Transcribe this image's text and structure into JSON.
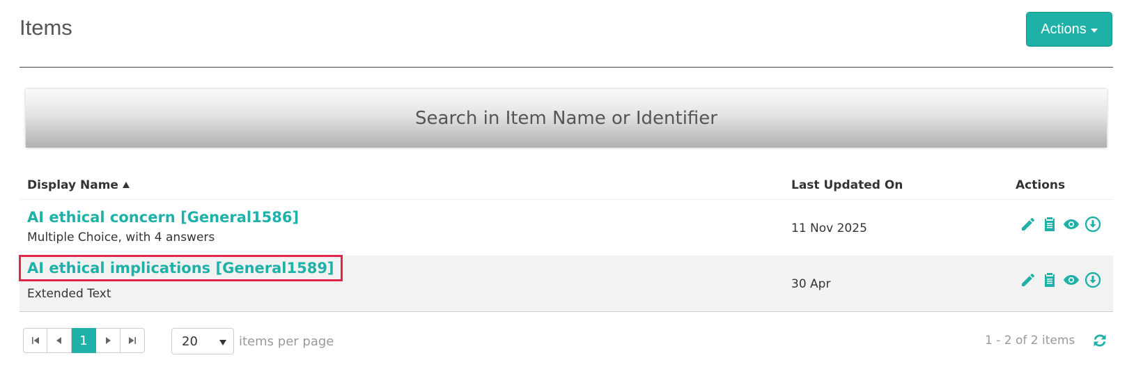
{
  "header": {
    "title": "Items",
    "actions_label": "Actions"
  },
  "search": {
    "placeholder": "Search in Item Name or Identifier"
  },
  "table": {
    "columns": [
      "Display Name",
      "Last Updated On",
      "Actions"
    ],
    "sort": {
      "column": "Display Name",
      "direction": "ascending"
    },
    "rows": [
      {
        "title": "AI ethical concern [General1586]",
        "subtitle": "Multiple Choice, with 4 answers",
        "date": "11 Nov 2025",
        "actions": [
          "pencil-icon",
          "clipboard-icon",
          "eye-icon",
          "download-icon"
        ]
      },
      {
        "title": "AI ethical implications [General1589]",
        "subtitle": "Extended Text",
        "date": "30 Apr",
        "actions": [
          "pencil-icon",
          "clipboard-icon",
          "eye-icon",
          "download-icon"
        ]
      }
    ]
  },
  "pagination": {
    "current_page": "1",
    "per_page": "20",
    "per_page_label": "items per page",
    "range_text": "1 - 2 of 2 items"
  },
  "colors": {
    "accent": "#1fb1a8",
    "highlight": "#e0264a"
  }
}
